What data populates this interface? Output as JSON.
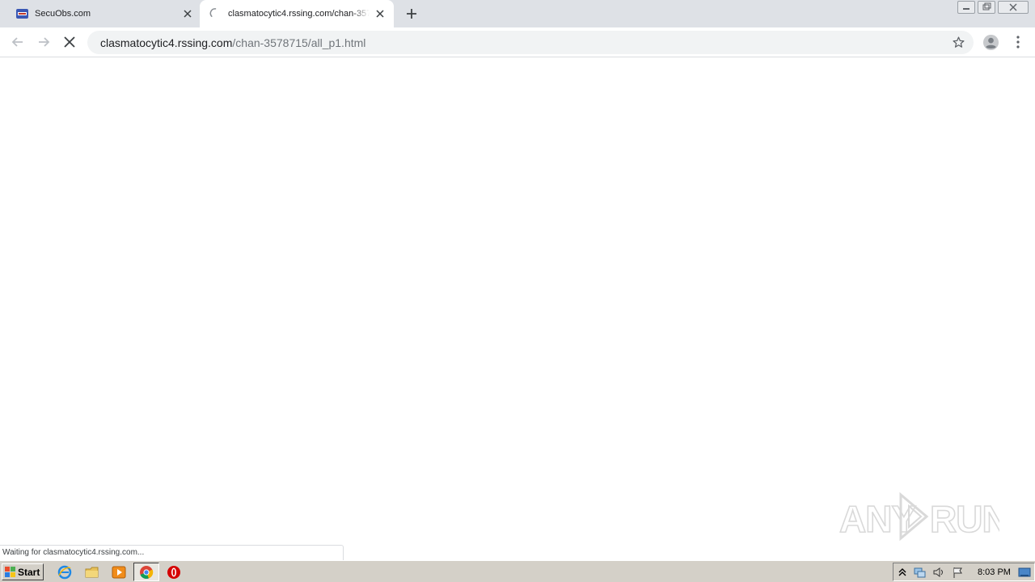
{
  "browser": {
    "tabs": [
      {
        "title": "SecuObs.com",
        "active": false
      },
      {
        "title": "clasmatocytic4.rssing.com/chan-3578715/all_p1.html",
        "active": true
      }
    ],
    "address": {
      "host": "clasmatocytic4.rssing.com",
      "path": "/chan-3578715/all_p1.html"
    },
    "status_text": "Waiting for clasmatocytic4.rssing.com..."
  },
  "watermark": {
    "text_left": "ANY",
    "text_right": "RUN"
  },
  "taskbar": {
    "start_label": "Start",
    "clock": "8:03 PM"
  },
  "colors": {
    "tabstrip": "#dee1e6",
    "omnibox": "#f1f3f4",
    "taskbar": "#d4d0c8",
    "secuobs_favicon": "#3a57b4"
  },
  "icons": [
    "secuobs-favicon",
    "loading-spinner-icon",
    "close-icon",
    "plus-icon",
    "back-arrow-icon",
    "forward-arrow-icon",
    "stop-icon",
    "star-icon",
    "profile-icon",
    "menu-dots-icon",
    "windows-flag-icon",
    "ie-icon",
    "folder-icon",
    "media-player-icon",
    "chrome-icon",
    "opera-icon",
    "chevron-up-icon",
    "network-icon",
    "speaker-icon",
    "action-center-flag-icon",
    "show-desktop-icon"
  ]
}
